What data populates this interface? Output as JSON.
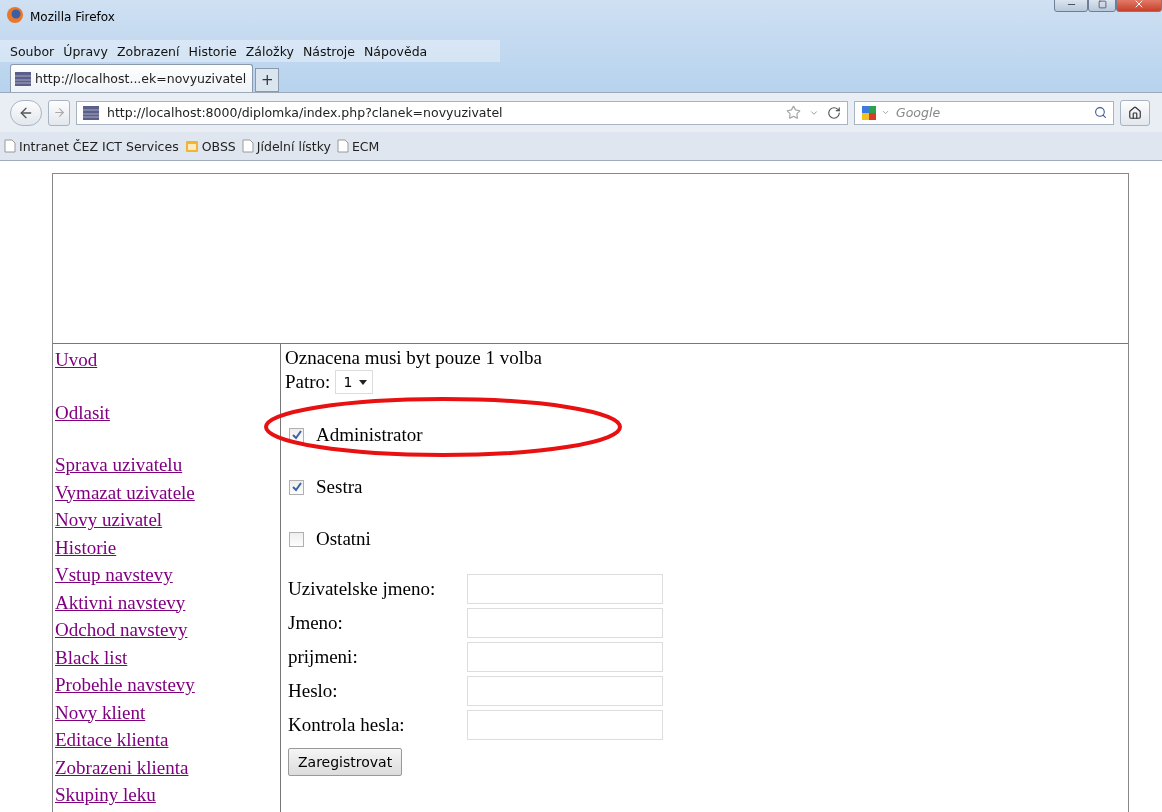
{
  "window": {
    "title": "Mozilla Firefox"
  },
  "menu": [
    {
      "label": "Soubor"
    },
    {
      "label": "Úpravy"
    },
    {
      "label": "Zobrazení"
    },
    {
      "label": "Historie"
    },
    {
      "label": "Záložky"
    },
    {
      "label": "Nástroje"
    },
    {
      "label": "Nápověda"
    }
  ],
  "tabs": [
    {
      "label": "http://localhost...ek=novyuzivatel",
      "selected": true
    }
  ],
  "new_tab_button": "+",
  "address_bar": {
    "value": "http://localhost:8000/diplomka/index.php?clanek=novyuzivatel"
  },
  "search": {
    "placeholder": "Google"
  },
  "bookmarks": [
    {
      "label": "Intranet ČEZ ICT Services",
      "kind": "page"
    },
    {
      "label": "OBSS",
      "kind": "folder"
    },
    {
      "label": "Jídelní lístky",
      "kind": "page"
    },
    {
      "label": "ECM",
      "kind": "page"
    }
  ],
  "sidebar": {
    "groups": [
      [
        {
          "label": "Uvod"
        }
      ],
      [
        {
          "label": "Odlasit"
        }
      ],
      [
        {
          "label": "Sprava uzivatelu"
        },
        {
          "label": "Vymazat uzivatele"
        },
        {
          "label": "Novy uzivatel"
        },
        {
          "label": "Historie"
        },
        {
          "label": "Vstup navstevy"
        },
        {
          "label": "Aktivni navstevy"
        },
        {
          "label": "Odchod navstevy"
        },
        {
          "label": "Black list"
        },
        {
          "label": "Probehle navstevy"
        },
        {
          "label": "Novy klient"
        },
        {
          "label": "Editace klienta"
        },
        {
          "label": "Zobrazeni klienta"
        },
        {
          "label": "Skupiny leku"
        }
      ]
    ]
  },
  "form": {
    "notice": "Oznacena musi byt pouze 1 volba",
    "floor": {
      "label": "Patro:",
      "value": "1"
    },
    "roles": [
      {
        "label": "Administrator",
        "checked": true
      },
      {
        "label": "Sestra",
        "checked": true
      },
      {
        "label": "Ostatni",
        "checked": false
      }
    ],
    "fields": [
      {
        "label": "Uzivatelske jmeno:"
      },
      {
        "label": "Jmeno:"
      },
      {
        "label": "prijmeni:"
      },
      {
        "label": "Heslo:"
      },
      {
        "label": "Kontrola hesla:"
      }
    ],
    "submit": "Zaregistrovat"
  },
  "annotation": {
    "kind": "ellipse"
  }
}
